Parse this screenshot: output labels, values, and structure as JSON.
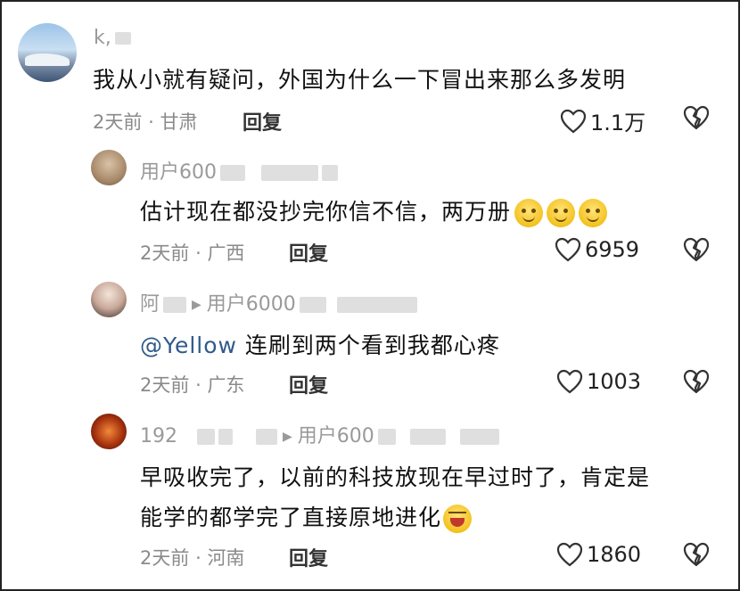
{
  "comments": [
    {
      "username_visible": "k,",
      "text": "我从小就有疑问，外国为什么一下冒出来那么多发明",
      "time": "2天前",
      "location": "甘肃",
      "reply_label": "回复",
      "likes": "1.1万"
    },
    {
      "username_visible": "用户600",
      "text": "估计现在都没抄完你信不信，两万册",
      "time": "2天前",
      "location": "广西",
      "reply_label": "回复",
      "likes": "6959"
    },
    {
      "username_visible": "阿",
      "reply_to_visible": "用户6000",
      "mention": "@Yellow",
      "text": "连刷到两个看到我都心疼",
      "time": "2天前",
      "location": "广东",
      "reply_label": "回复",
      "likes": "1003"
    },
    {
      "username_visible": "192",
      "reply_to_visible": "用户600",
      "text_line1": "早吸收完了，以前的科技放现在早过时了，肯定是",
      "text_line2": "能学的都学完了直接原地进化",
      "time": "2天前",
      "location": "河南",
      "reply_label": "回复",
      "likes": "1860"
    }
  ],
  "separator": "·",
  "icons": [
    "heart-outline-icon",
    "broken-heart-icon",
    "play-arrow-icon"
  ]
}
